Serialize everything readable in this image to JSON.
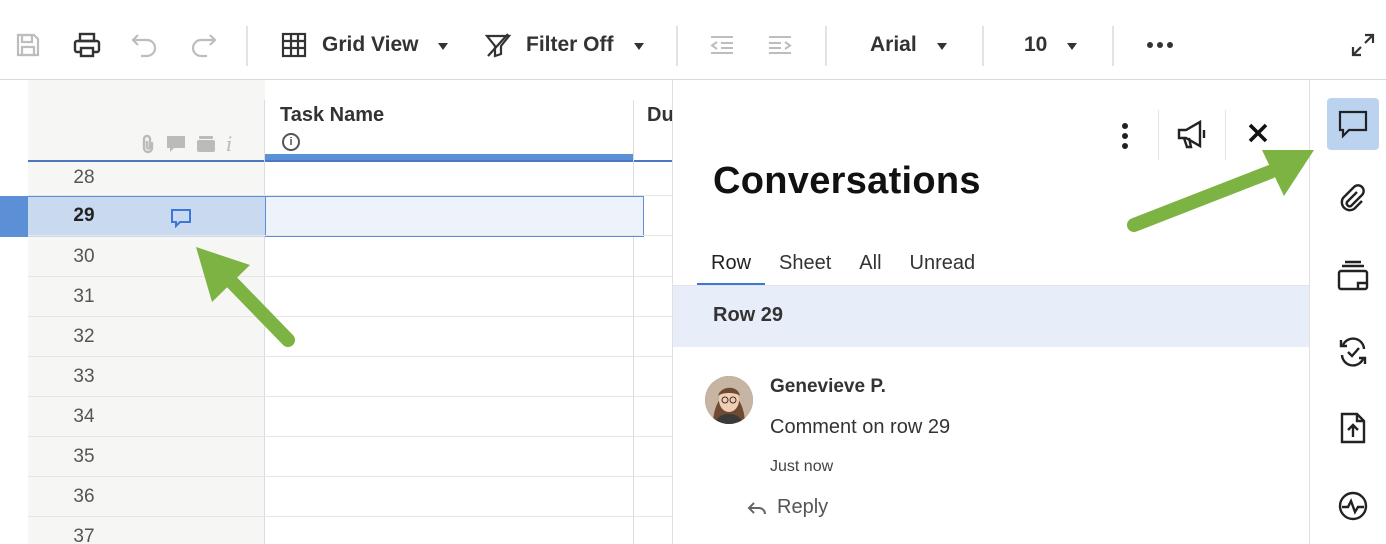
{
  "toolbar": {
    "view_label": "Grid View",
    "filter_label": "Filter Off",
    "font_label": "Arial",
    "size_label": "10",
    "icons": [
      "save-icon",
      "print-icon",
      "undo-icon",
      "redo-icon",
      "grid-view-icon",
      "filter-icon",
      "outdent-icon",
      "indent-icon",
      "more-icon",
      "expand-icon"
    ]
  },
  "grid": {
    "columns": {
      "task_name": "Task Name",
      "next_col_partial": "Du"
    },
    "rows": [
      "28",
      "29",
      "30",
      "31",
      "32",
      "33",
      "34",
      "35",
      "36",
      "37"
    ],
    "selected_row": "29"
  },
  "panel": {
    "title": "Conversations",
    "tabs": [
      "Row",
      "Sheet",
      "All",
      "Unread"
    ],
    "active_tab": "Row",
    "banner": "Row 29",
    "comment": {
      "author": "Genevieve P.",
      "text": "Comment on row 29",
      "time": "Just now",
      "reply_label": "Reply"
    }
  },
  "rail": {
    "icons": [
      "conversations-icon",
      "attachments-icon",
      "proofing-icon",
      "update-requests-icon",
      "publish-icon",
      "activity-log-icon"
    ],
    "active": "conversations-icon"
  },
  "colors": {
    "accent": "#3b78d8",
    "selection": "#c9d9f0",
    "arrow": "#7cb342"
  }
}
